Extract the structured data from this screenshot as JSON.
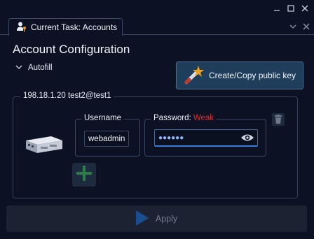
{
  "tab": {
    "label": "Current Task: Accounts"
  },
  "page": {
    "title": "Account Configuration"
  },
  "autofill": {
    "label": "Autofill"
  },
  "pubkey_button": {
    "label": "Create/Copy public key"
  },
  "host": {
    "label": "198.18.1.20 test2@test1",
    "username": {
      "legend": "Username",
      "value": "webadmin"
    },
    "password": {
      "legend": "Password:",
      "strength": "Weak",
      "masked_value": "●●●●●●"
    }
  },
  "apply_button": {
    "label": "Apply"
  },
  "icons": {
    "window": [
      "minimize-icon",
      "maximize-icon",
      "close-icon"
    ],
    "tab": "user-key-icon",
    "pubkey": "magic-wand-icon",
    "device": "server-appliance-icon",
    "eye": "eye-icon",
    "trash": "trash-icon",
    "add": "plus-icon",
    "apply": "play-icon"
  },
  "colors": {
    "accent": "#3b7ddb",
    "weak": "#e03030",
    "add": "#2e7d46"
  }
}
